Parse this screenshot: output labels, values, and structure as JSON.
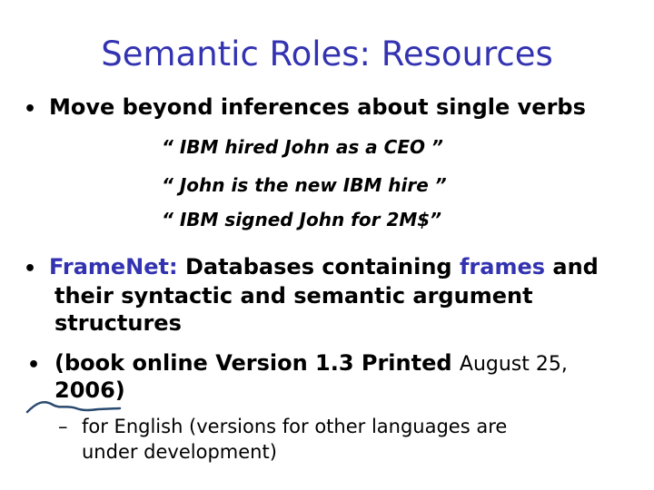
{
  "slide": {
    "title": "Semantic Roles: Resources",
    "bullets": [
      {
        "text": "Move beyond inferences about single verbs"
      },
      {
        "prefix": "FrameNet:",
        "text_a": " Databases containing ",
        "highlight": "frames",
        "text_b": " and",
        "line2": "their syntactic and semantic argument",
        "line3": "structures"
      },
      {
        "text_a": "(book online Version 1.3  Printed ",
        "text_b": "August 25,",
        "line2": "2006)"
      }
    ],
    "examples": [
      "“ IBM hired John as a CEO  ”",
      "“ John is the new IBM hire ”",
      "“ IBM signed John for 2M$”"
    ],
    "sub_bullet": {
      "dash": "–",
      "line1": "for English (versions for other languages are",
      "line2": "under development)"
    },
    "bullet_glyph": "•",
    "colors": {
      "title": "#3333b2",
      "highlight": "#3333b2",
      "squiggle": "#2a4a70"
    }
  }
}
